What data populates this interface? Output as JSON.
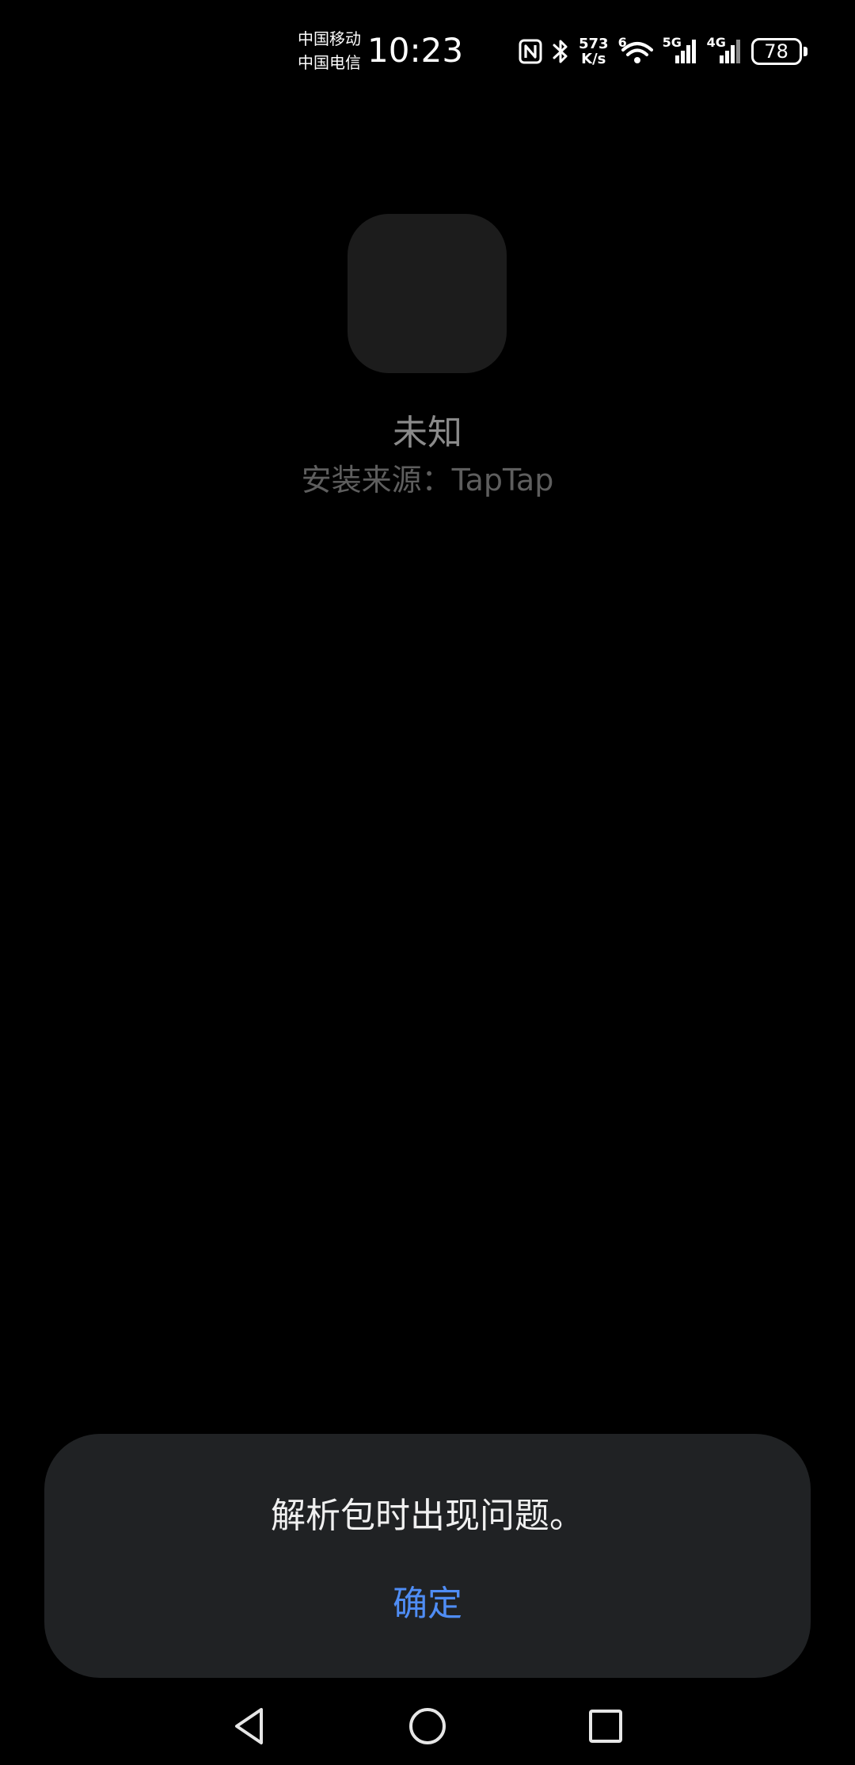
{
  "status_bar": {
    "carrier_1": "中国移动",
    "carrier_2": "中国电信",
    "time": "10:23",
    "speed_value": "573",
    "speed_unit": "K/s",
    "wifi_label": "6",
    "network_1": "5G",
    "network_2": "4G",
    "battery_level": "78",
    "icons": [
      "nfc-icon",
      "bluetooth-icon",
      "wifi-icon",
      "signal-5g-icon",
      "signal-4g-icon",
      "battery-icon"
    ]
  },
  "app_info": {
    "name": "未知",
    "install_source": "安装来源：TapTap"
  },
  "dialog": {
    "message": "解析包时出现问题。",
    "confirm_label": "确定",
    "accent_color": "#4f8df5"
  },
  "nav_bar": {
    "icons": [
      "back-icon",
      "home-icon",
      "recents-icon"
    ]
  }
}
